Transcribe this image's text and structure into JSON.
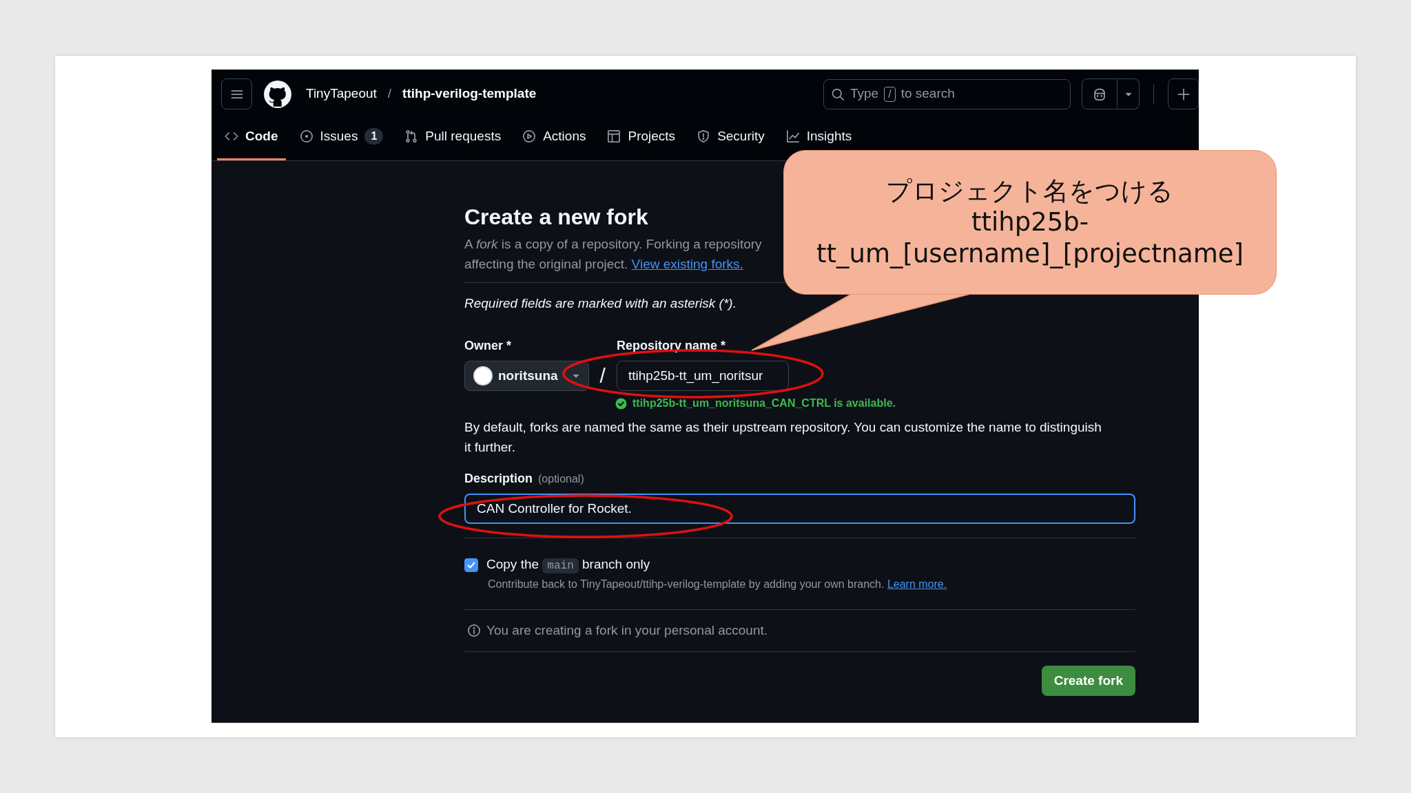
{
  "header": {
    "owner": "TinyTapeout",
    "separator": "/",
    "repo": "ttihp-verilog-template",
    "search": {
      "before": "Type",
      "key": "/",
      "after": "to search"
    }
  },
  "tabs": [
    {
      "label": "Code",
      "kind": "code",
      "selected": true
    },
    {
      "label": "Issues",
      "kind": "issue",
      "count": "1",
      "selected": false
    },
    {
      "label": "Pull requests",
      "kind": "pull",
      "selected": false
    },
    {
      "label": "Actions",
      "kind": "play",
      "selected": false
    },
    {
      "label": "Projects",
      "kind": "table",
      "selected": false
    },
    {
      "label": "Security",
      "kind": "shield",
      "selected": false
    },
    {
      "label": "Insights",
      "kind": "graph",
      "selected": false
    }
  ],
  "form": {
    "title": "Create a new fork",
    "intro": "A *fork* is a copy of a repository. Forking a repository",
    "intro_line2": "affecting the original project.",
    "intro_link": "View existing forks.",
    "required_note": "Required fields are marked with an asterisk (*).",
    "owner": {
      "label": "Owner *",
      "value": "noritsuna"
    },
    "separator": "/",
    "repo_name": {
      "label": "Repository name *",
      "value": "ttihp25b-tt_um_noritsur"
    },
    "availability": "ttihp25b-tt_um_noritsuna_CAN_CTRL is available.",
    "default_note": "By default, forks are named the same as their upstream repository. You can customize the name to distinguish it further.",
    "description": {
      "label": "Description",
      "hint": "(optional)",
      "value": "CAN Controller for Rocket."
    },
    "copy_branch": {
      "checked": true,
      "label_before": "Copy the",
      "branch": "main",
      "label_after": "branch only",
      "note": "Contribute back to TinyTapeout/ttihp-verilog-template by adding your own branch.",
      "link": "Learn more."
    },
    "info": "You are creating a fork in your personal account.",
    "submit": "Create fork"
  },
  "annotation": {
    "callout_lines": [
      "プロジェクト名をつける",
      "ttihp25b-",
      "tt_um_[username]_[projectname]"
    ]
  }
}
